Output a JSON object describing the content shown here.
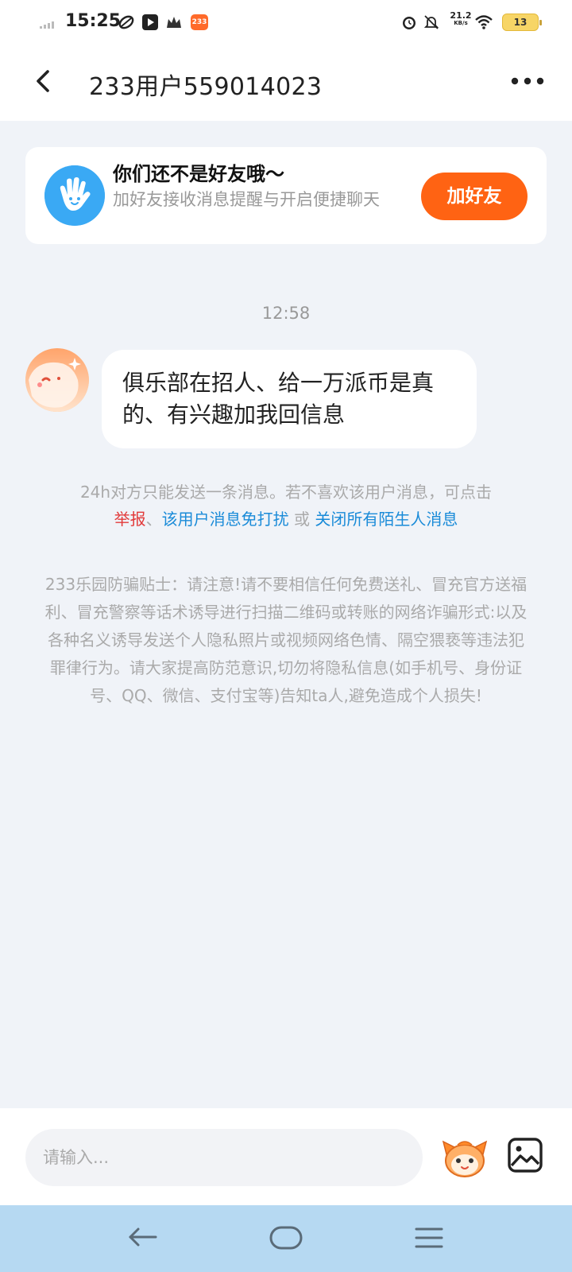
{
  "status_bar": {
    "time": "15:25",
    "badge_233": "233",
    "net_speed_value": "21.2",
    "net_speed_unit": "KB/s",
    "battery": "13",
    "icons": [
      "signal-icon",
      "leaf-icon",
      "play-icon",
      "crown-icon",
      "app-233-icon",
      "alarm-icon",
      "mute-icon",
      "wifi-icon",
      "battery-icon"
    ]
  },
  "header": {
    "title": "233用户559014023",
    "back_icon": "chevron-left-icon",
    "more_icon": "more-dots-icon"
  },
  "friend_card": {
    "title": "你们还不是好友哦～",
    "subtitle": "加好友接收消息提醒与开启便捷聊天",
    "button": "加好友",
    "icon": "hand-wave-icon",
    "accent_color": "#ff6313"
  },
  "chat": {
    "timestamp": "12:58",
    "message": "俱乐部在招人、给一万派币是真的、有兴趣加我回信息"
  },
  "notice": {
    "text": "24h对方只能发送一条消息。若不喜欢该用户消息，可点击",
    "report_link": "举报",
    "sep1": "、",
    "mute_link": "该用户消息免打扰",
    "sep2": " 或 ",
    "close_link": "关闭所有陌生人消息",
    "link_colors": {
      "report": "#e23a3a",
      "blue": "#1a8bd8"
    }
  },
  "warning": {
    "text": "233乐园防骗贴士：请注意!请不要相信任何免费送礼、冒充官方送福利、冒充警察等话术诱导进行扫描二维码或转账的网络诈骗形式:以及各种名义诱导发送个人隐私照片或视频网络色情、隔空猥亵等违法犯罪律行为。请大家提高防范意识,切勿将隐私信息(如手机号、身份证号、QQ、微信、支付宝等)告知ta人,避免造成个人损失!"
  },
  "input_bar": {
    "placeholder": "请输入...",
    "emoji_icon": "mascot-emoji-icon",
    "image_icon": "image-icon"
  },
  "nav_bar": {
    "icons": [
      "nav-back-icon",
      "nav-home-icon",
      "nav-menu-icon"
    ],
    "color": "#b6d9f2"
  }
}
